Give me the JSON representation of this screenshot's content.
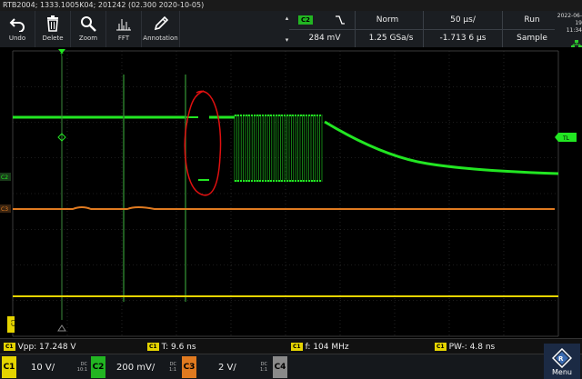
{
  "title": "RTB2004; 1333.1005K04; 201242 (02.300 2020-10-05)",
  "toolbar": {
    "undo": "Undo",
    "delete": "Delete",
    "zoom": "Zoom",
    "fft": "FFT",
    "annotation": "Annotation"
  },
  "trigger": {
    "source": "C2",
    "level": "284 mV",
    "mode": "Norm",
    "sample_rate": "1.25 GSa/s",
    "timebase": "50 µs/",
    "position": "-1.713 6 µs",
    "run_state": "Run",
    "acq_mode": "Sample"
  },
  "clock": {
    "date": "2022-06-19",
    "time": "11:34"
  },
  "markers": {
    "tl": "TL",
    "c2": "C2",
    "c3": "C3",
    "c1": "C1"
  },
  "measurements": [
    {
      "tag": "C1",
      "text": "Vpp: 17.248 V"
    },
    {
      "tag": "C1",
      "text": "T: 9.6 ns"
    },
    {
      "tag": "C1",
      "text": "f: 104 MHz"
    },
    {
      "tag": "C1",
      "text": "PW-: 4.8 ns"
    }
  ],
  "channels": [
    {
      "tag": "C1",
      "value": "10 V/",
      "coupling": "DC",
      "ratio": "10:1",
      "color": "#e5d400"
    },
    {
      "tag": "C2",
      "value": "200 mV/",
      "coupling": "DC",
      "ratio": "1:1",
      "color": "#22b522"
    },
    {
      "tag": "C3",
      "value": "2 V/",
      "coupling": "DC",
      "ratio": "1:1",
      "color": "#e07a20"
    },
    {
      "tag": "C4",
      "value": "",
      "coupling": "",
      "ratio": "",
      "color": "#8a8a8a"
    }
  ],
  "menu": "Menu",
  "colors": {
    "c1": "#e5d400",
    "c2": "#22e622",
    "c3": "#e07a20",
    "annotation": "#e01010",
    "grid": "#3a3a3a"
  }
}
